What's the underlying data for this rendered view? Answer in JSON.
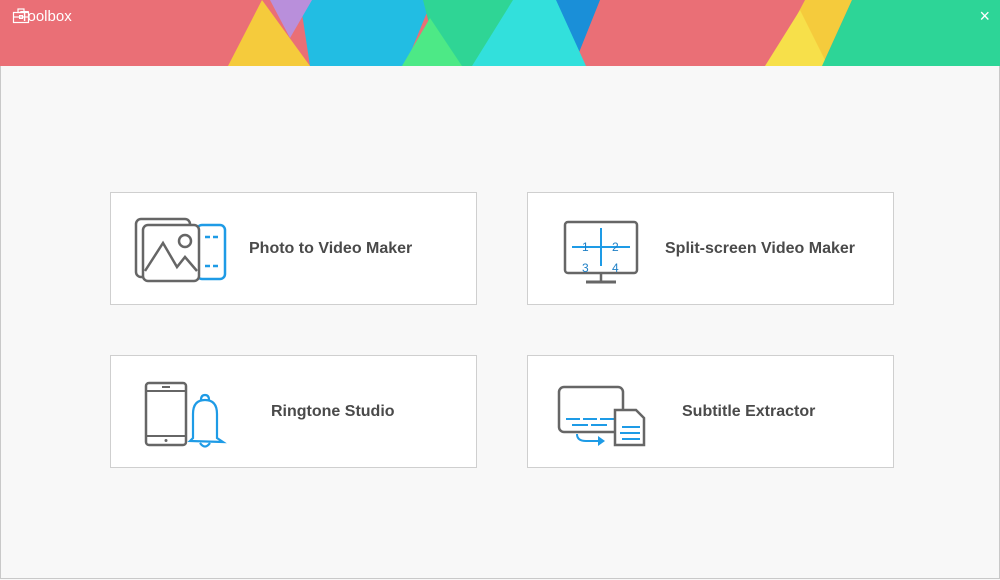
{
  "window": {
    "title": "Toolbox",
    "close_label": "×"
  },
  "colors": {
    "accent_blue": "#1e9be6",
    "icon_gray": "#666666"
  },
  "tools": [
    {
      "label": "Photo to Video Maker",
      "icon": "photo-film-icon"
    },
    {
      "label": "Split-screen Video Maker",
      "icon": "split-screen-monitor-icon",
      "panes": [
        "1",
        "2",
        "3",
        "4"
      ]
    },
    {
      "label": "Ringtone Studio",
      "icon": "phone-bell-icon"
    },
    {
      "label": "Subtitle Extractor",
      "icon": "subtitle-document-icon"
    }
  ]
}
